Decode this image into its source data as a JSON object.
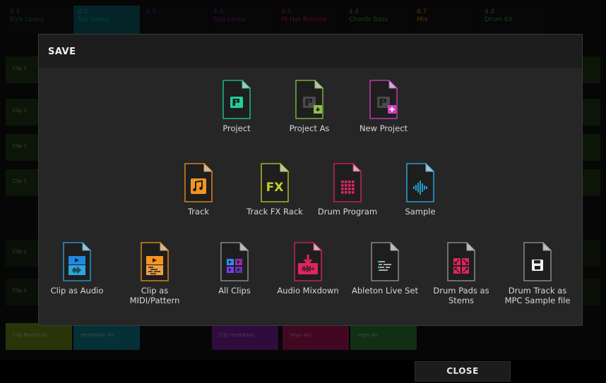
{
  "background": {
    "tracks": [
      {
        "num": "4.1",
        "name": "Kick Loops",
        "color": "#2e7d32"
      },
      {
        "num": "4.2",
        "name": "Top Loops",
        "color": "#00acc1"
      },
      {
        "num": "4.3",
        "name": "",
        "color": "#1e40d0"
      },
      {
        "num": "4.4",
        "name": "Sub Loops",
        "color": "#8e24aa"
      },
      {
        "num": "4.5",
        "name": "Hi Hat Bounce",
        "color": "#d81b60"
      },
      {
        "num": "4.6",
        "name": "Chords Bass",
        "color": "#43a047"
      },
      {
        "num": "4.7",
        "name": "Mix",
        "color": "#f57c00"
      },
      {
        "num": "4.8",
        "name": "Drum Kit",
        "color": "#43a047"
      }
    ],
    "bottom_clips": [
      {
        "label": "Clip Raytheon",
        "color": "#6d8b16"
      },
      {
        "label": "Heatwave Arc",
        "color": "#0e7f8f"
      },
      {
        "label": "Clip Heatwave",
        "color": "#7b1fa2"
      },
      {
        "label": "Vega Arc",
        "color": "#ad1457"
      },
      {
        "label": "Vega Arc",
        "color": "#2e7d32"
      }
    ],
    "side_label": "Clip 1"
  },
  "dialog": {
    "title": "SAVE",
    "rows": [
      [
        {
          "id": "project",
          "label": "Project",
          "icon": "project-icon",
          "color": "#1fcf9a"
        },
        {
          "id": "project-as",
          "label": "Project As",
          "icon": "project-as-icon",
          "color": "#8bc34a"
        },
        {
          "id": "new-project",
          "label": "New Project",
          "icon": "new-project-icon",
          "color": "#d63fc0"
        }
      ],
      [
        {
          "id": "track",
          "label": "Track",
          "icon": "music-note-icon",
          "color": "#f7941d"
        },
        {
          "id": "track-fx-rack",
          "label": "Track FX Rack",
          "icon": "fx-icon",
          "color": "#c3d12a"
        },
        {
          "id": "drum-program",
          "label": "Drum Program",
          "icon": "pad-grid-icon",
          "color": "#e0245e"
        },
        {
          "id": "sample",
          "label": "Sample",
          "icon": "waveform-icon",
          "color": "#29b6f6"
        }
      ],
      [
        {
          "id": "clip-as-audio",
          "label": "Clip as Audio",
          "icon": "clip-audio-icon",
          "color": "#29a8e0"
        },
        {
          "id": "clip-as-midi",
          "label": "Clip as MIDI/Pattern",
          "icon": "clip-midi-icon",
          "color": "#f7941d"
        },
        {
          "id": "all-clips",
          "label": "All Clips",
          "icon": "all-clips-icon",
          "color": "#7c3aed"
        },
        {
          "id": "audio-mixdown",
          "label": "Audio Mixdown",
          "icon": "mixdown-icon",
          "color": "#e0245e"
        },
        {
          "id": "ableton-live-set",
          "label": "Ableton Live Set",
          "icon": "ableton-icon",
          "color": "#e6e6e6"
        },
        {
          "id": "drum-pads-stems",
          "label": "Drum Pads as Stems",
          "icon": "stems-icon",
          "color": "#e0245e"
        },
        {
          "id": "drum-track-mpc",
          "label": "Drum Track as MPC Sample file",
          "icon": "floppy-icon",
          "color": "#f2f2f2"
        }
      ]
    ]
  },
  "footer": {
    "close_label": "CLOSE"
  }
}
